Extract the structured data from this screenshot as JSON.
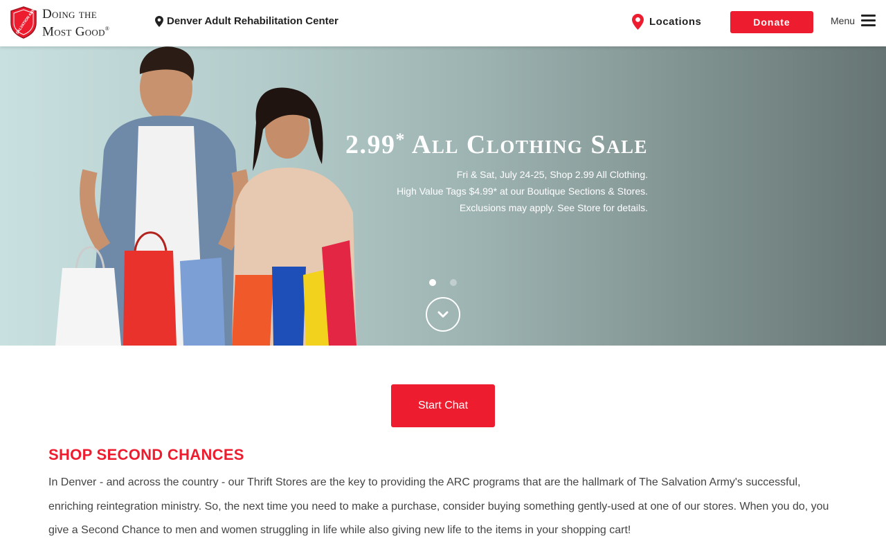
{
  "header": {
    "tagline_line1": "Doing the",
    "tagline_line2": "Most Good",
    "tagline_mark": "®",
    "logo_text": "THE SALVATION ARMY",
    "center_name": "Denver Adult Rehabilitation Center",
    "locations_label": "Locations",
    "donate_label": "Donate",
    "menu_label": "Menu"
  },
  "hero": {
    "title_price": "2.99",
    "title_star": "*",
    "title_text": " All Clothing Sale",
    "line1": "Fri & Sat, July 24-25, Shop 2.99 All Clothing.",
    "line2": "High Value Tags $4.99* at our Boutique Sections & Stores.",
    "line3": "Exclusions may apply. See Store for details.",
    "slides_count": 2,
    "active_slide": 1
  },
  "chat": {
    "button_label": "Start Chat"
  },
  "section": {
    "title": "SHOP SECOND CHANCES",
    "body": "In Denver - and across the country - our Thrift Stores are the key to providing the ARC programs that are the hallmark of The Salvation Army's successful, enriching reintegration ministry. So, the next time you need to make a purchase, consider buying something gently-used at one of our stores. When you do, you give a Second Chance to men and women struggling in life while also giving new life to the items in your shopping cart!"
  },
  "colors": {
    "brand_red": "#ed1c2e",
    "text_dark": "#222222",
    "body_text": "#444444"
  },
  "icons": {
    "logo": "salvation-army-shield-icon",
    "center": "map-pin-icon",
    "locations": "location-marker-icon",
    "menu": "hamburger-menu-icon",
    "scroll": "chevron-down-icon"
  }
}
